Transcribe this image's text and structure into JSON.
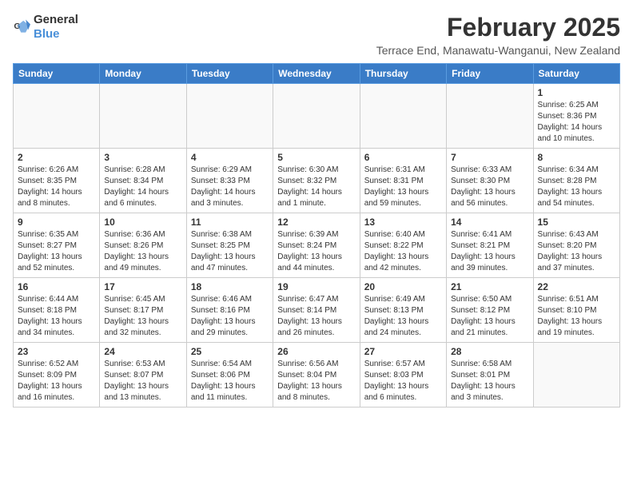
{
  "header": {
    "logo_general": "General",
    "logo_blue": "Blue",
    "month_title": "February 2025",
    "subtitle": "Terrace End, Manawatu-Wanganui, New Zealand"
  },
  "weekdays": [
    "Sunday",
    "Monday",
    "Tuesday",
    "Wednesday",
    "Thursday",
    "Friday",
    "Saturday"
  ],
  "weeks": [
    [
      {
        "day": "",
        "info": ""
      },
      {
        "day": "",
        "info": ""
      },
      {
        "day": "",
        "info": ""
      },
      {
        "day": "",
        "info": ""
      },
      {
        "day": "",
        "info": ""
      },
      {
        "day": "",
        "info": ""
      },
      {
        "day": "1",
        "info": "Sunrise: 6:25 AM\nSunset: 8:36 PM\nDaylight: 14 hours\nand 10 minutes."
      }
    ],
    [
      {
        "day": "2",
        "info": "Sunrise: 6:26 AM\nSunset: 8:35 PM\nDaylight: 14 hours\nand 8 minutes."
      },
      {
        "day": "3",
        "info": "Sunrise: 6:28 AM\nSunset: 8:34 PM\nDaylight: 14 hours\nand 6 minutes."
      },
      {
        "day": "4",
        "info": "Sunrise: 6:29 AM\nSunset: 8:33 PM\nDaylight: 14 hours\nand 3 minutes."
      },
      {
        "day": "5",
        "info": "Sunrise: 6:30 AM\nSunset: 8:32 PM\nDaylight: 14 hours\nand 1 minute."
      },
      {
        "day": "6",
        "info": "Sunrise: 6:31 AM\nSunset: 8:31 PM\nDaylight: 13 hours\nand 59 minutes."
      },
      {
        "day": "7",
        "info": "Sunrise: 6:33 AM\nSunset: 8:30 PM\nDaylight: 13 hours\nand 56 minutes."
      },
      {
        "day": "8",
        "info": "Sunrise: 6:34 AM\nSunset: 8:28 PM\nDaylight: 13 hours\nand 54 minutes."
      }
    ],
    [
      {
        "day": "9",
        "info": "Sunrise: 6:35 AM\nSunset: 8:27 PM\nDaylight: 13 hours\nand 52 minutes."
      },
      {
        "day": "10",
        "info": "Sunrise: 6:36 AM\nSunset: 8:26 PM\nDaylight: 13 hours\nand 49 minutes."
      },
      {
        "day": "11",
        "info": "Sunrise: 6:38 AM\nSunset: 8:25 PM\nDaylight: 13 hours\nand 47 minutes."
      },
      {
        "day": "12",
        "info": "Sunrise: 6:39 AM\nSunset: 8:24 PM\nDaylight: 13 hours\nand 44 minutes."
      },
      {
        "day": "13",
        "info": "Sunrise: 6:40 AM\nSunset: 8:22 PM\nDaylight: 13 hours\nand 42 minutes."
      },
      {
        "day": "14",
        "info": "Sunrise: 6:41 AM\nSunset: 8:21 PM\nDaylight: 13 hours\nand 39 minutes."
      },
      {
        "day": "15",
        "info": "Sunrise: 6:43 AM\nSunset: 8:20 PM\nDaylight: 13 hours\nand 37 minutes."
      }
    ],
    [
      {
        "day": "16",
        "info": "Sunrise: 6:44 AM\nSunset: 8:18 PM\nDaylight: 13 hours\nand 34 minutes."
      },
      {
        "day": "17",
        "info": "Sunrise: 6:45 AM\nSunset: 8:17 PM\nDaylight: 13 hours\nand 32 minutes."
      },
      {
        "day": "18",
        "info": "Sunrise: 6:46 AM\nSunset: 8:16 PM\nDaylight: 13 hours\nand 29 minutes."
      },
      {
        "day": "19",
        "info": "Sunrise: 6:47 AM\nSunset: 8:14 PM\nDaylight: 13 hours\nand 26 minutes."
      },
      {
        "day": "20",
        "info": "Sunrise: 6:49 AM\nSunset: 8:13 PM\nDaylight: 13 hours\nand 24 minutes."
      },
      {
        "day": "21",
        "info": "Sunrise: 6:50 AM\nSunset: 8:12 PM\nDaylight: 13 hours\nand 21 minutes."
      },
      {
        "day": "22",
        "info": "Sunrise: 6:51 AM\nSunset: 8:10 PM\nDaylight: 13 hours\nand 19 minutes."
      }
    ],
    [
      {
        "day": "23",
        "info": "Sunrise: 6:52 AM\nSunset: 8:09 PM\nDaylight: 13 hours\nand 16 minutes."
      },
      {
        "day": "24",
        "info": "Sunrise: 6:53 AM\nSunset: 8:07 PM\nDaylight: 13 hours\nand 13 minutes."
      },
      {
        "day": "25",
        "info": "Sunrise: 6:54 AM\nSunset: 8:06 PM\nDaylight: 13 hours\nand 11 minutes."
      },
      {
        "day": "26",
        "info": "Sunrise: 6:56 AM\nSunset: 8:04 PM\nDaylight: 13 hours\nand 8 minutes."
      },
      {
        "day": "27",
        "info": "Sunrise: 6:57 AM\nSunset: 8:03 PM\nDaylight: 13 hours\nand 6 minutes."
      },
      {
        "day": "28",
        "info": "Sunrise: 6:58 AM\nSunset: 8:01 PM\nDaylight: 13 hours\nand 3 minutes."
      },
      {
        "day": "",
        "info": ""
      }
    ]
  ]
}
